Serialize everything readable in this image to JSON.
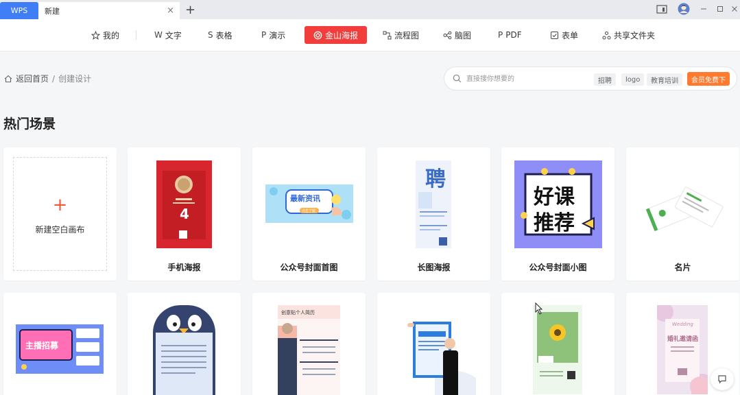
{
  "titlebar": {
    "app_tab": "WPS",
    "doc_tab": "新建",
    "close_glyph": "×",
    "new_tab_glyph": "+"
  },
  "nav": {
    "items": [
      {
        "label": "我的",
        "icon": "star-icon"
      },
      {
        "label": "文字",
        "icon": "writer-icon"
      },
      {
        "label": "表格",
        "icon": "sheet-icon"
      },
      {
        "label": "演示",
        "icon": "slides-icon"
      },
      {
        "label": "金山海报",
        "icon": "poster-icon",
        "active": true
      },
      {
        "label": "流程图",
        "icon": "flowchart-icon"
      },
      {
        "label": "脑图",
        "icon": "mindmap-icon"
      },
      {
        "label": "PDF",
        "icon": "pdf-icon"
      },
      {
        "label": "表单",
        "icon": "form-icon"
      },
      {
        "label": "共享文件夹",
        "icon": "shared-folder-icon"
      }
    ]
  },
  "breadcrumb": {
    "home": "返回首页",
    "separator": "/",
    "current": "创建设计"
  },
  "search": {
    "placeholder": "直接搜你想要的",
    "tags": [
      "招聘",
      "logo",
      "教育培训"
    ],
    "promo": "会员免费下"
  },
  "section_title": "热门场景",
  "blank_card": {
    "plus": "+",
    "label": "新建空白画布"
  },
  "cards": [
    {
      "label": "手机海报"
    },
    {
      "label": "公众号封面首图"
    },
    {
      "label": "长图海报"
    },
    {
      "label": "公众号封面小图"
    },
    {
      "label": "名片"
    }
  ],
  "thumb_text": {
    "wechat_cover": "最新资讯",
    "wechat_cover_sub": "点击了解",
    "long_poster": "聘",
    "small_cover_line1": "好课",
    "small_cover_line2": "推荐",
    "live_recruit": "主播招募",
    "resume": "创意贴个人简历",
    "wedding_en": "Wedding",
    "wedding": "婚礼邀请函",
    "medal_num": "4"
  },
  "colors": {
    "accent_red": "#f23d3d",
    "wps_blue": "#3f7ef7",
    "promo_orange": "#ff7a2e"
  }
}
